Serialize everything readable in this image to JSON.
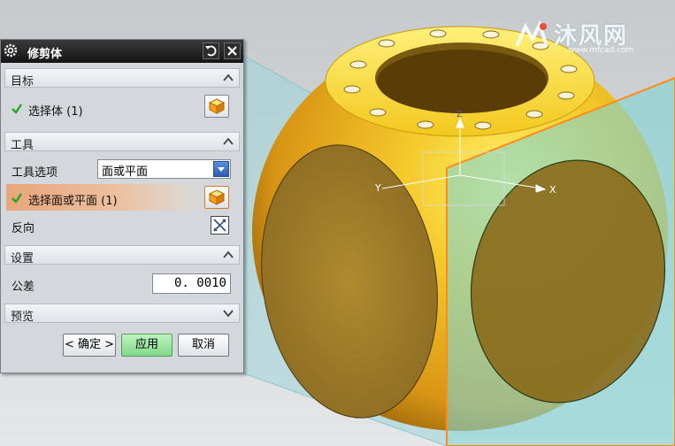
{
  "dialog": {
    "title": "修剪体",
    "sections": {
      "target": "目标",
      "tool": "工具",
      "settings": "设置",
      "preview": "预览"
    },
    "select_body": "选择体 (1)",
    "tool_option_label": "工具选项",
    "tool_option_value": "面或平面",
    "select_face": "选择面或平面 (1)",
    "reverse_label": "反向",
    "tolerance_label": "公差",
    "tolerance_value": "0. 0010",
    "buttons": {
      "ok": "< 确定 >",
      "apply": "应用",
      "cancel": "取消"
    }
  },
  "viewport": {
    "axes": {
      "x": "X",
      "y": "Y",
      "z": "Z"
    }
  },
  "watermark": {
    "text": "沐风网",
    "url": "www.mfcad.com"
  },
  "colors": {
    "part_yellow": "#e8b21a",
    "plane_cyan": "#7fd3d3",
    "plane_edge": "#ff8c1a",
    "highlight": "#e8a679",
    "apply_green": "#7ed88a"
  },
  "icons": [
    "gear-icon",
    "reset-icon",
    "close-icon",
    "check-icon",
    "cube-select-icon",
    "reverse-direction-icon",
    "collapse-chevron-icon",
    "expand-chevron-icon",
    "dropdown-arrow-icon"
  ]
}
